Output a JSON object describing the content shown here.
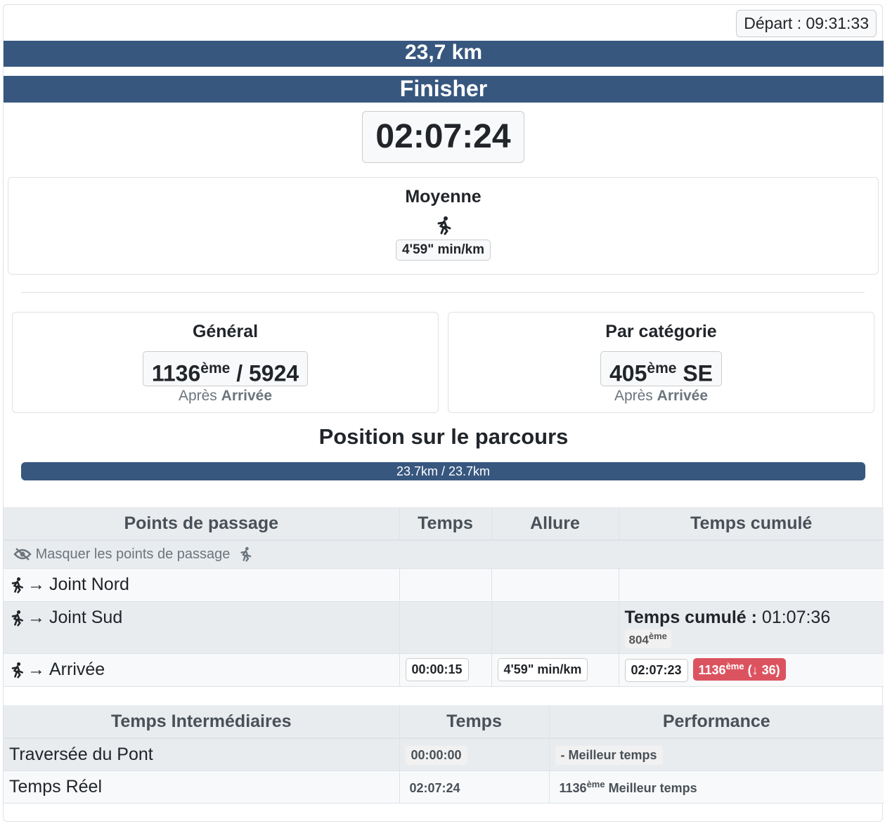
{
  "header": {
    "depart": "Départ : 09:31:33",
    "distance": "23,7 km",
    "status": "Finisher",
    "time": "02:07:24"
  },
  "moyenne": {
    "title": "Moyenne",
    "pace": "4'59\" min/km"
  },
  "general": {
    "title": "Général",
    "rank": "1136",
    "sup": "ème",
    "total": " / 5924",
    "apres": "Après ",
    "apres_bold": "Arrivée"
  },
  "categorie": {
    "title": "Par catégorie",
    "rank": "405",
    "sup": "ème",
    "cat": " SE",
    "apres": "Après ",
    "apres_bold": "Arrivée"
  },
  "position": {
    "title": "Position sur le parcours",
    "progress_label": "23.7km / 23.7km",
    "progress": 1.0
  },
  "checkpoints": {
    "headers": [
      "Points de passage",
      "Temps",
      "Allure",
      "Temps cumulé"
    ],
    "mask_label": "Masquer les points de passage",
    "rows": [
      {
        "name": "Joint Nord"
      },
      {
        "name": "Joint Sud",
        "cum_label": "Temps cumulé :",
        "cum_value": " 01:07:36",
        "rank": "804",
        "rank_sup": "ème"
      },
      {
        "name": "Arrivée",
        "temps": "00:00:15",
        "allure": "4'59\" min/km",
        "cum": "02:07:23",
        "rank": "1136",
        "rank_sup": "ème",
        "change": " (↓ 36)"
      }
    ]
  },
  "intermediaires": {
    "headers": [
      "Temps Intermédiaires",
      "Temps",
      "Performance"
    ],
    "rows": [
      {
        "name": "Traversée du Pont",
        "temps": "00:00:00",
        "perf": "- Meilleur temps"
      },
      {
        "name": "Temps Réel",
        "temps": "02:07:24",
        "perf_rank": "1136",
        "perf_sup": "ème",
        "perf": " Meilleur temps"
      }
    ]
  },
  "colors": {
    "primary": "#37577f",
    "danger": "#dc5360"
  }
}
